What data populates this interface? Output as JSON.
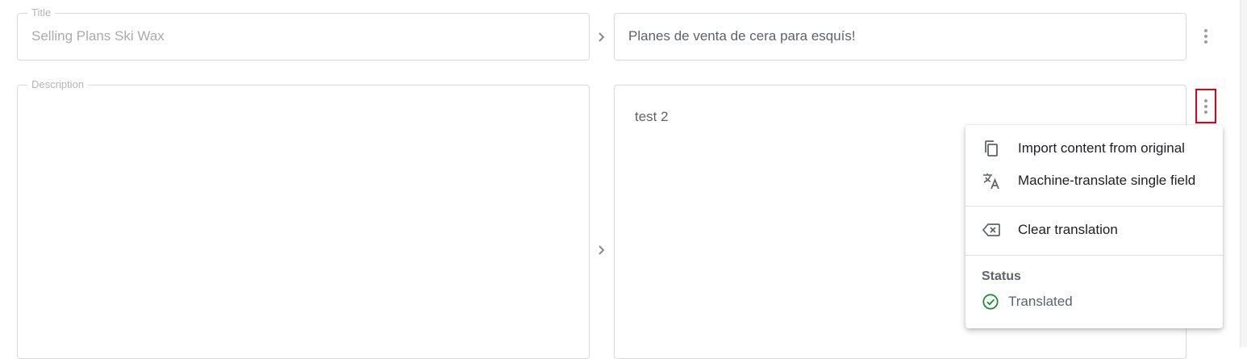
{
  "title_field": {
    "label": "Title",
    "original_value": "Selling Plans Ski Wax",
    "translated_value": "Planes de venta de cera para esquís!"
  },
  "description_field": {
    "label": "Description",
    "original_value": "",
    "translated_value": "test 2"
  },
  "context_menu": {
    "items": [
      {
        "label": "Import content from original",
        "icon": "copy-icon"
      },
      {
        "label": "Machine-translate single field",
        "icon": "translate-icon"
      },
      {
        "label": "Clear translation",
        "icon": "backspace-icon"
      }
    ],
    "status_heading": "Status",
    "status_value": "Translated",
    "status_icon": "check-circle-icon"
  },
  "colors": {
    "status_success": "#1e8e3e",
    "highlight_border": "#e0001b"
  }
}
